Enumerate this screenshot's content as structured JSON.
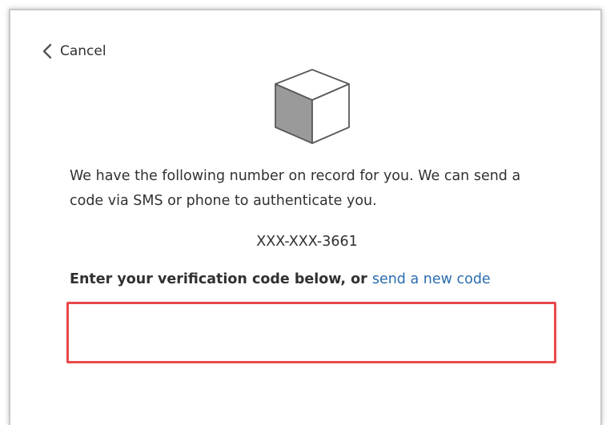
{
  "nav": {
    "cancel_label": "Cancel",
    "back_icon": "chevron-left-icon"
  },
  "logo": {
    "icon": "cube-icon"
  },
  "message": {
    "description": "We have the following number on record for you. We can send a code via SMS or phone to authenticate you.",
    "phone_number": "XXX-XXX-3661"
  },
  "verification": {
    "prompt_text": "Enter your verification code below, or ",
    "resend_link": "send a new code",
    "code_value": "",
    "code_placeholder": ""
  },
  "colors": {
    "link": "#2b6cb0",
    "highlight_border": "#e8474b",
    "text": "#323130"
  }
}
